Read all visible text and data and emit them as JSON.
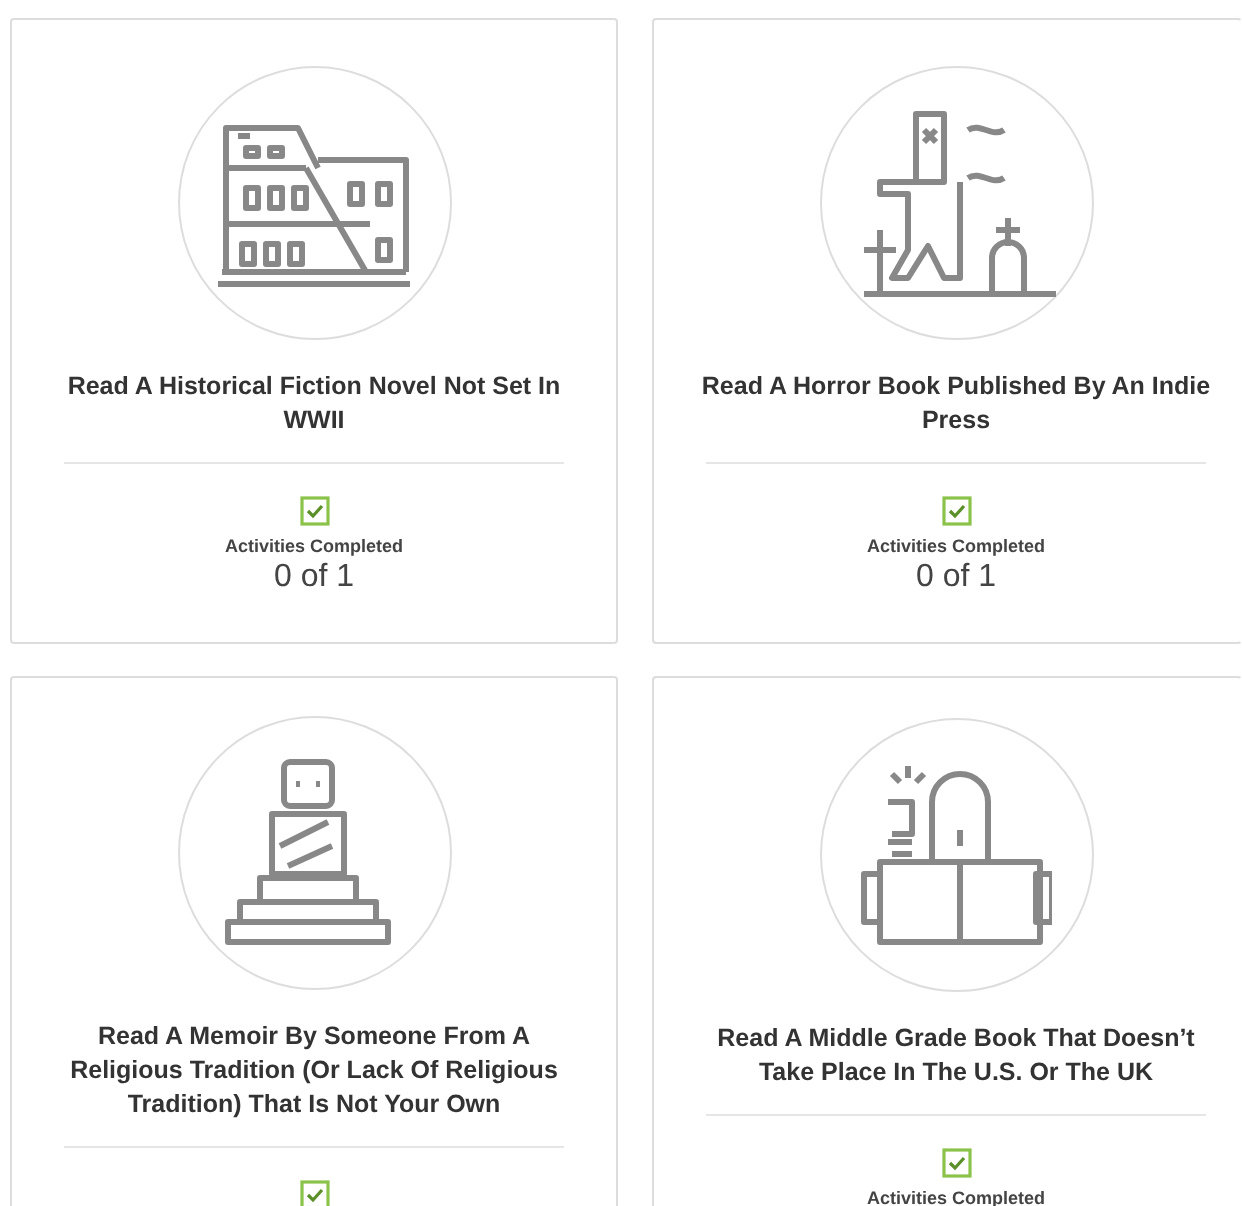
{
  "cards": [
    {
      "kind": "colosseum",
      "title": "Read A Historical Fiction Novel Not Set In WWII",
      "checked": true,
      "label": "Activities Completed",
      "count": "0 of 1"
    },
    {
      "kind": "zombie",
      "title": "Read A Horror Book Published By An Indie Press",
      "checked": true,
      "label": "Activities Completed",
      "count": "0 of 1"
    },
    {
      "kind": "statue",
      "title": "Read A Memoir By Someone From A Religious Tradition (Or Lack Of Religious Tradition) That Is Not Your Own",
      "checked": true
    },
    {
      "kind": "book",
      "title": "Read A Middle Grade Book That Doesn’t Take Place In The U.S. Or The UK",
      "checked": true,
      "label": "Activities Completed"
    }
  ]
}
